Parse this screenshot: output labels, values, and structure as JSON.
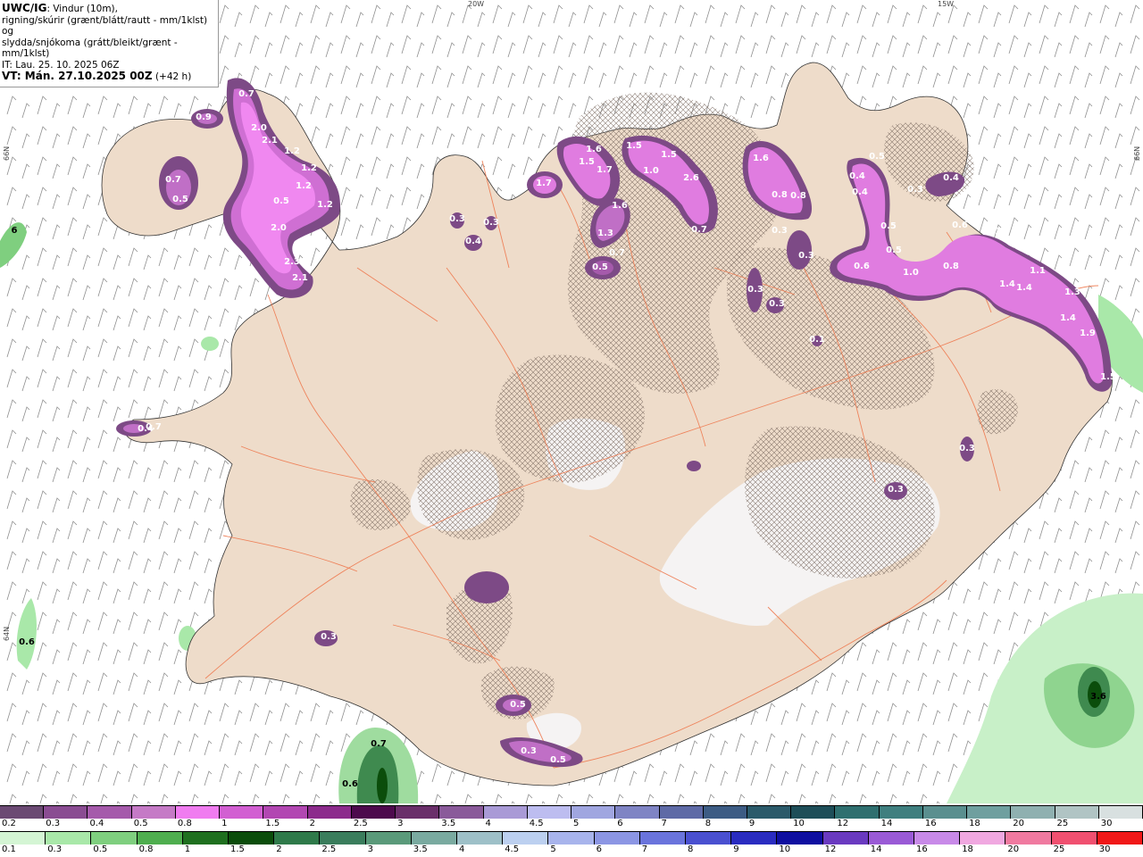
{
  "header": {
    "model": "UWC/IG",
    "line1_rest": ": Vindur (10m),",
    "line2": "rigning/skúrir (grænt/blátt/rautt - mm/1klst) og",
    "line3": "slydda/snjókoma (grátt/bleikt/grænt - mm/1klst)",
    "line4": "IT: Lau. 25. 10. 2025 06Z",
    "vt_label": "VT: Mán. 27.10.2025 00Z",
    "vt_offset": "(+42 h)"
  },
  "grid_labels": {
    "lon_20w": "20W",
    "lon_15w": "15W",
    "lat_66n_left": "66N",
    "lat_66n_right": "66N",
    "lat_64n_left": "64N"
  },
  "snow_scale": [
    "0.2",
    "0.3",
    "0.4",
    "0.5",
    "0.8",
    "1",
    "1.5",
    "2",
    "2.5",
    "3",
    "3.5",
    "4",
    "4.5",
    "5",
    "6",
    "7",
    "8",
    "9",
    "10",
    "12",
    "14",
    "16",
    "18",
    "20",
    "25",
    "30"
  ],
  "snow_colors": [
    "#6b4a73",
    "#8a4c92",
    "#a55aab",
    "#c57ac6",
    "#f07cf0",
    "#d25fd2",
    "#b247b2",
    "#8c2b8c",
    "#4d0a4d",
    "#6a2f6a",
    "#8a5a9a",
    "#a99ad6",
    "#bdbdf0",
    "#a0a6e0",
    "#7f84c4",
    "#5e6aa6",
    "#3d5c84",
    "#2b5a6a",
    "#1e4e58",
    "#2f6f6f",
    "#3f7f7f",
    "#5a8f8f",
    "#6f9f9f",
    "#8fb0b0",
    "#b0c4c4",
    "#d8e0e0"
  ],
  "rain_scale": [
    "0.1",
    "0.3",
    "0.5",
    "0.8",
    "1",
    "1.5",
    "2",
    "2.5",
    "3",
    "3.5",
    "4",
    "4.5",
    "5",
    "6",
    "7",
    "8",
    "9",
    "10",
    "12",
    "14",
    "16",
    "18",
    "20",
    "25",
    "30"
  ],
  "rain_colors": [
    "#d4f5d4",
    "#a9e8a9",
    "#7fcf7f",
    "#4fae4f",
    "#1f6f1f",
    "#0b4d0b",
    "#2f7a4a",
    "#3a7d5c",
    "#5a9a7a",
    "#7aaaa0",
    "#9ec0c8",
    "#bcd0f0",
    "#a8b4ec",
    "#8c96e4",
    "#6a74dc",
    "#4a50d0",
    "#2a2cc0",
    "#0f0fa0",
    "#6a3ac0",
    "#9a5ad6",
    "#c88ae8",
    "#f0a8e0",
    "#f07aa0",
    "#f05070",
    "#f01818"
  ],
  "values": {
    "westfjords": [
      "0.7",
      "0.9",
      "2.0",
      "2.1",
      "1.2",
      "1.2",
      "1.2",
      "0.5",
      "1.2",
      "2.0",
      "2.3",
      "2.1",
      "0.7",
      "0.5"
    ],
    "north": [
      "1.6",
      "1.5",
      "1.7",
      "1.5",
      "1.0",
      "1.5",
      "2.6",
      "1.7",
      "1.6",
      "1.3",
      "0.5",
      "0.7",
      "0.7",
      "1.6",
      "0.8",
      "0.8",
      "0.3",
      "0.3"
    ],
    "northeast": [
      "0.5",
      "0.4",
      "0.4",
      "0.3",
      "0.4",
      "0.5",
      "0.5",
      "1.0",
      "0.6",
      "0.8",
      "0.6",
      "2.1",
      "1.1",
      "0.9",
      "1.4",
      "1.4",
      "1.3",
      "1.4",
      "1.9",
      "1.5"
    ],
    "misc": [
      "0.3",
      "0.4",
      "0.3",
      "0.3",
      "0.3",
      "0.5",
      "0.3",
      "0.5",
      "0.3",
      "0.3",
      "0.7",
      "0.4",
      "0.3",
      "0.1",
      "3.6",
      "0.6",
      "0.7",
      "0.6",
      "6"
    ]
  }
}
